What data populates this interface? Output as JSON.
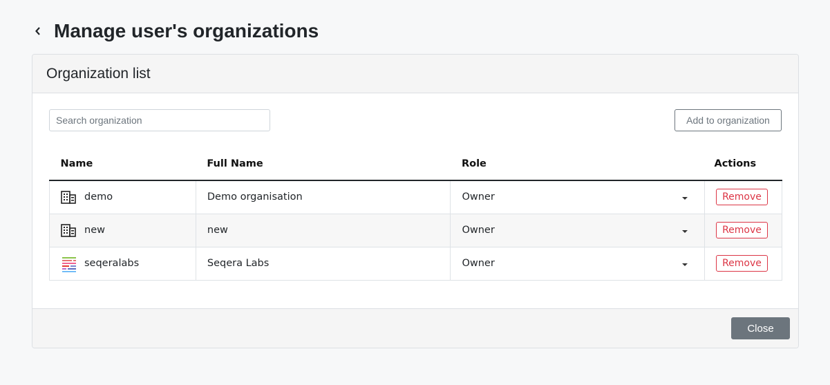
{
  "page": {
    "title": "Manage user's organizations"
  },
  "card": {
    "title": "Organization list",
    "search": {
      "placeholder": "Search organization",
      "value": ""
    },
    "add_button": "Add to organization",
    "close_button": "Close"
  },
  "table": {
    "headers": {
      "name": "Name",
      "full_name": "Full Name",
      "role": "Role",
      "actions": "Actions"
    },
    "rows": [
      {
        "name": "demo",
        "full_name": "Demo organisation",
        "role": "Owner",
        "action": "Remove",
        "icon": "building-icon"
      },
      {
        "name": "new",
        "full_name": "new",
        "role": "Owner",
        "action": "Remove",
        "icon": "building-icon"
      },
      {
        "name": "seqeralabs",
        "full_name": "Seqera Labs",
        "role": "Owner",
        "action": "Remove",
        "icon": "seqera-logo-icon"
      }
    ]
  },
  "colors": {
    "danger": "#dc3545",
    "secondary": "#6c757d",
    "text": "#212529"
  }
}
